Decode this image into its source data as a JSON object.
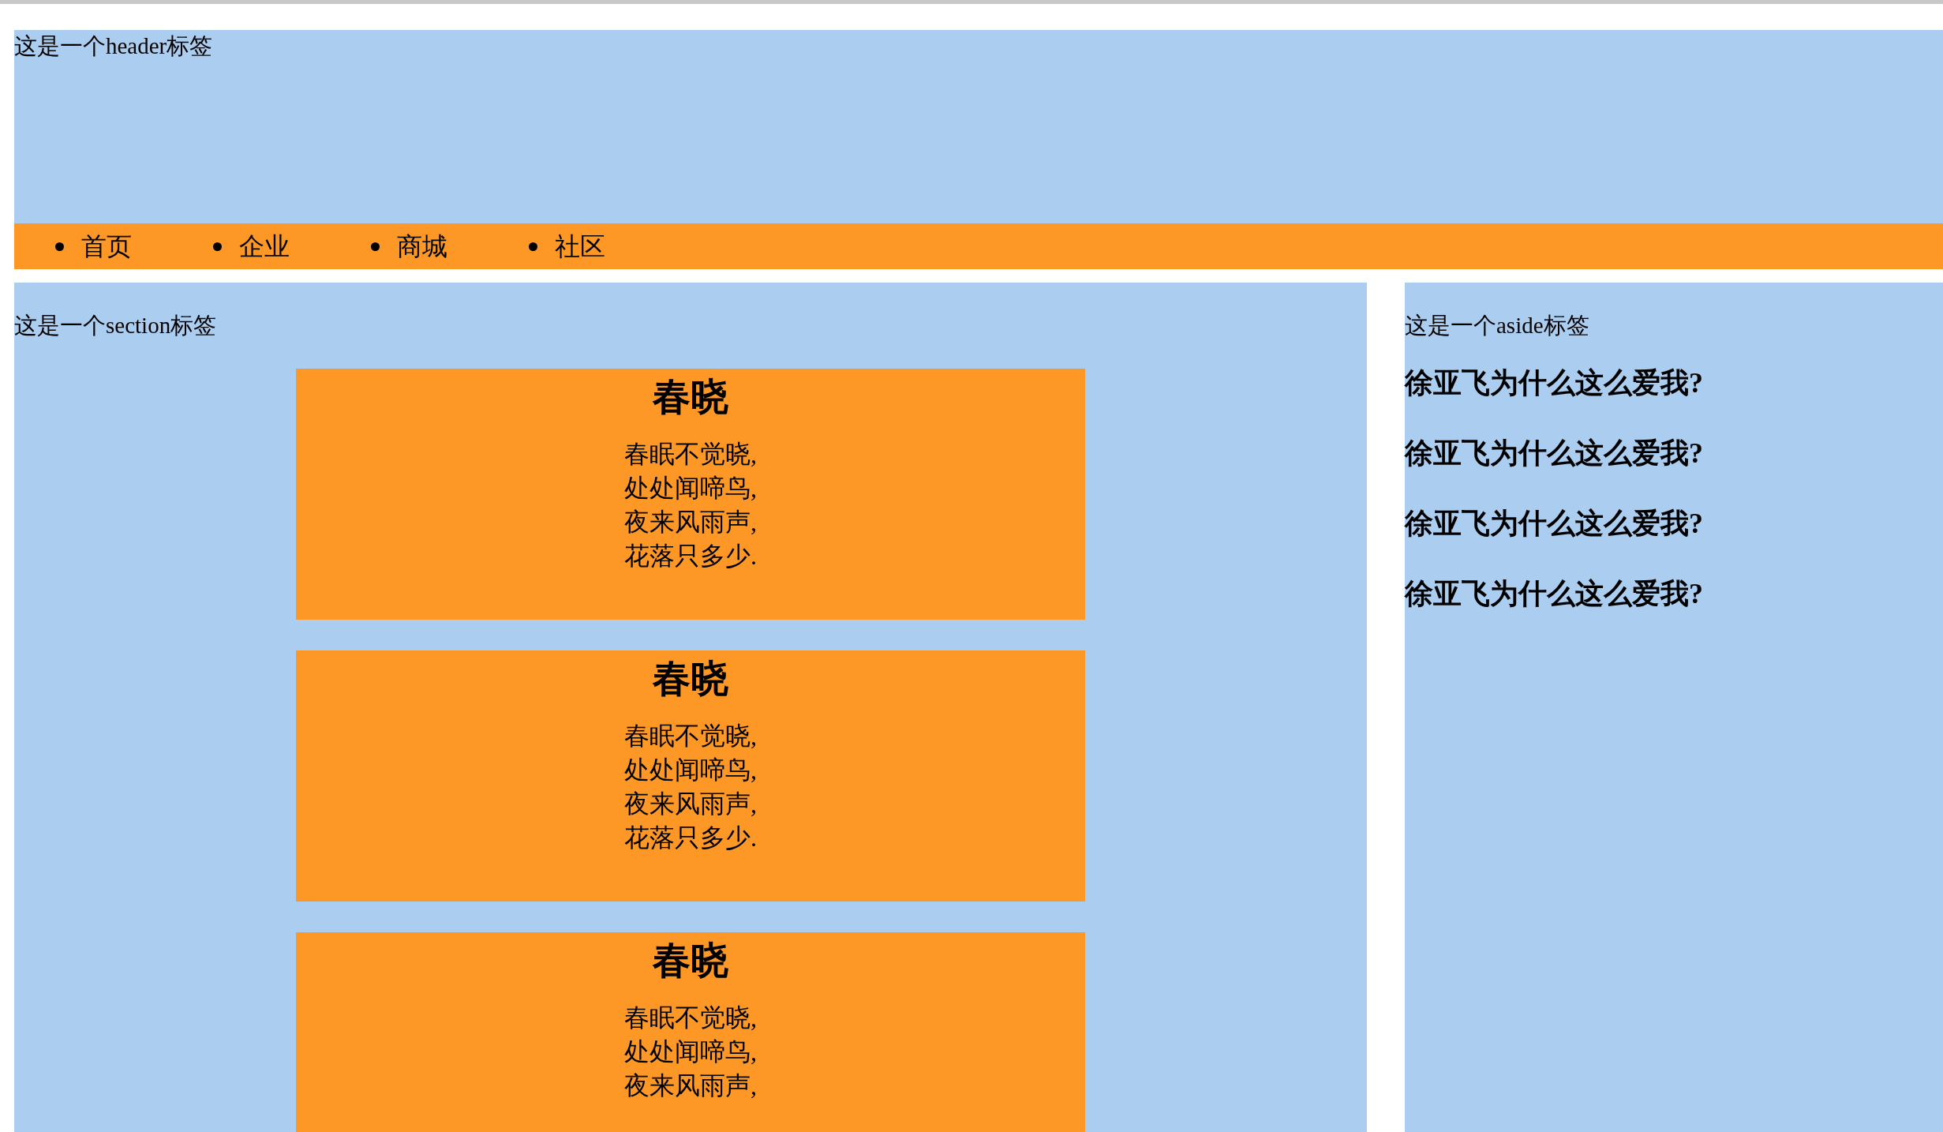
{
  "header": {
    "text": "这是一个header标签"
  },
  "nav": {
    "items": [
      "首页",
      "企业",
      "商城",
      "社区"
    ]
  },
  "section": {
    "text": "这是一个section标签",
    "poems": [
      {
        "title": "春晓",
        "lines": [
          "春眠不觉晓,",
          "处处闻啼鸟,",
          "夜来风雨声,",
          "花落只多少."
        ]
      },
      {
        "title": "春晓",
        "lines": [
          "春眠不觉晓,",
          "处处闻啼鸟,",
          "夜来风雨声,",
          "花落只多少."
        ]
      },
      {
        "title": "春晓",
        "lines": [
          "春眠不觉晓,",
          "处处闻啼鸟,",
          "夜来风雨声,"
        ]
      }
    ]
  },
  "aside": {
    "text": "这是一个aside标签",
    "headings": [
      "徐亚飞为什么这么爱我?",
      "徐亚飞为什么这么爱我?",
      "徐亚飞为什么这么爱我?",
      "徐亚飞为什么这么爱我?"
    ]
  }
}
